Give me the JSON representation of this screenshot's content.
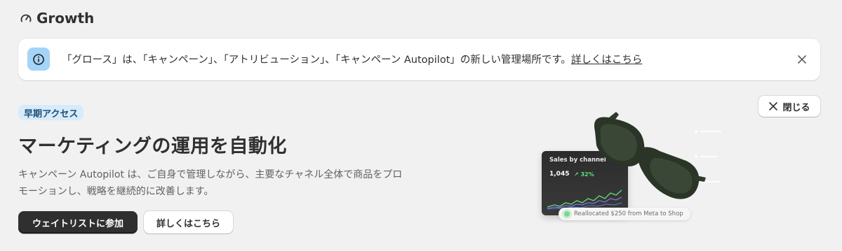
{
  "header": {
    "title": "Growth",
    "icon": "gauge-icon"
  },
  "banner": {
    "icon": "info-icon",
    "text": "「グロース」は、「キャンペーン」、「アトリビューション」、「キャンペーン Autopilot」の新しい管理場所です。",
    "link_label": "詳しくはこちら",
    "close_icon": "close-icon",
    "accent": "#a4d4f7"
  },
  "promo": {
    "badge": "早期アクセス",
    "heading": "マーケティングの運用を自動化",
    "description": "キャンペーン Autopilot は、ご自身で管理しながら、主要なチャネル全体で商品をプロモーションし、戦略を継続的に改善します。",
    "primary_button": "ウェイトリストに参加",
    "secondary_button": "詳しくはこちら",
    "dismiss_button": "閉じる",
    "badge_color": "#d7ebfb"
  },
  "illustration": {
    "card_title": "Sales by channel",
    "card_value": "1,045",
    "card_delta": "↗ 32%",
    "pill_text": "Reallocated $250 from Meta to Shop"
  }
}
